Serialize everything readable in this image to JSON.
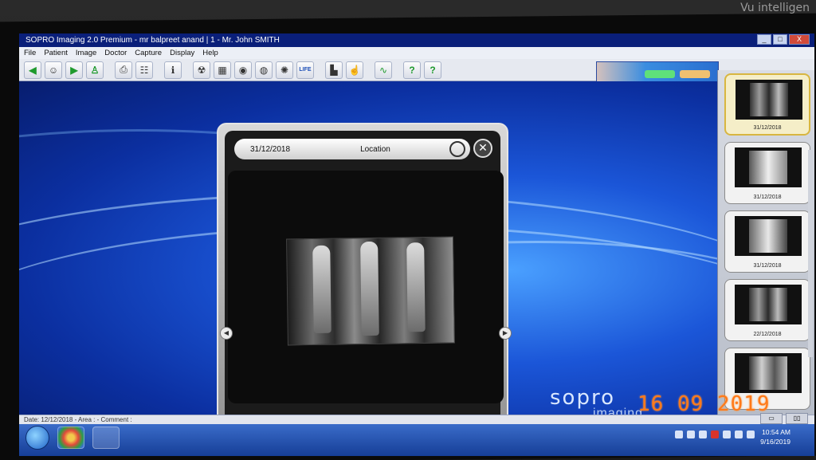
{
  "window": {
    "title": "SOPRO Imaging 2.0 Premium - mr balpreet anand | 1 - Mr. John SMITH",
    "controls": {
      "minimize": "_",
      "maximize": "□",
      "close": "X"
    }
  },
  "menu": {
    "items": [
      {
        "label": "File"
      },
      {
        "label": "Patient"
      },
      {
        "label": "Image"
      },
      {
        "label": "Doctor"
      },
      {
        "label": "Capture"
      },
      {
        "label": "Display"
      },
      {
        "label": "Help"
      }
    ]
  },
  "toolbar": {
    "buttons": [
      {
        "icon": "back-arrow-icon",
        "glyph": "◀"
      },
      {
        "icon": "patient-avatar-icon",
        "glyph": "☺"
      },
      {
        "icon": "forward-arrow-icon",
        "glyph": "▶"
      },
      {
        "icon": "patient-add-icon",
        "glyph": "♙"
      },
      {
        "icon": "printer-icon",
        "glyph": "⎙"
      },
      {
        "icon": "scanner-icon",
        "glyph": "☷"
      },
      {
        "icon": "info-icon",
        "glyph": "ℹ"
      },
      {
        "icon": "radiation-icon",
        "glyph": "☢"
      },
      {
        "icon": "layout-icon",
        "glyph": "▦"
      },
      {
        "icon": "tooth-camera-icon",
        "glyph": "◉"
      },
      {
        "icon": "intraoral-camera-icon",
        "glyph": "◍"
      },
      {
        "icon": "palette-icon",
        "glyph": "✺"
      },
      {
        "icon": "life-icon",
        "glyph": "LIFE"
      },
      {
        "icon": "staircase-icon",
        "glyph": "▙"
      },
      {
        "icon": "hand-select-icon",
        "glyph": "☝"
      },
      {
        "icon": "waveform-icon",
        "glyph": "∿"
      },
      {
        "icon": "help-icon",
        "glyph": "?"
      },
      {
        "icon": "help-life-icon",
        "glyph": "?"
      }
    ]
  },
  "wall_text": "Vu intelligen",
  "viewer": {
    "date": "31/12/2018",
    "location_label": "Location",
    "close_glyph": "✕",
    "nav_left": "◀",
    "nav_right": "▶",
    "tools": [
      {
        "icon": "rotate-icon",
        "glyph": "↻"
      },
      {
        "icon": "tooth-icon",
        "glyph": "♤"
      },
      {
        "icon": "tooth-section-icon",
        "glyph": "◐"
      },
      {
        "icon": "tooth-mesh-icon",
        "glyph": "♧"
      },
      {
        "icon": "move-arrows-icon",
        "glyph": "✥"
      },
      {
        "icon": "cup-icon",
        "glyph": "◒"
      }
    ]
  },
  "thumbnails": [
    {
      "caption": "31/12/2018",
      "selected": true
    },
    {
      "caption": "31/12/2018",
      "selected": false
    },
    {
      "caption": "31/12/2018",
      "selected": false
    },
    {
      "caption": "22/12/2018",
      "selected": false
    },
    {
      "caption": "",
      "selected": false
    }
  ],
  "statusbar": {
    "text": "Date: 12/12/2018 - Area : - Comment :"
  },
  "brand": {
    "main": "sopro",
    "sub": "imaging"
  },
  "taskbar": {
    "time": "10:54 AM",
    "date": "9/16/2019"
  },
  "camera_stamp": "16 09 2019"
}
